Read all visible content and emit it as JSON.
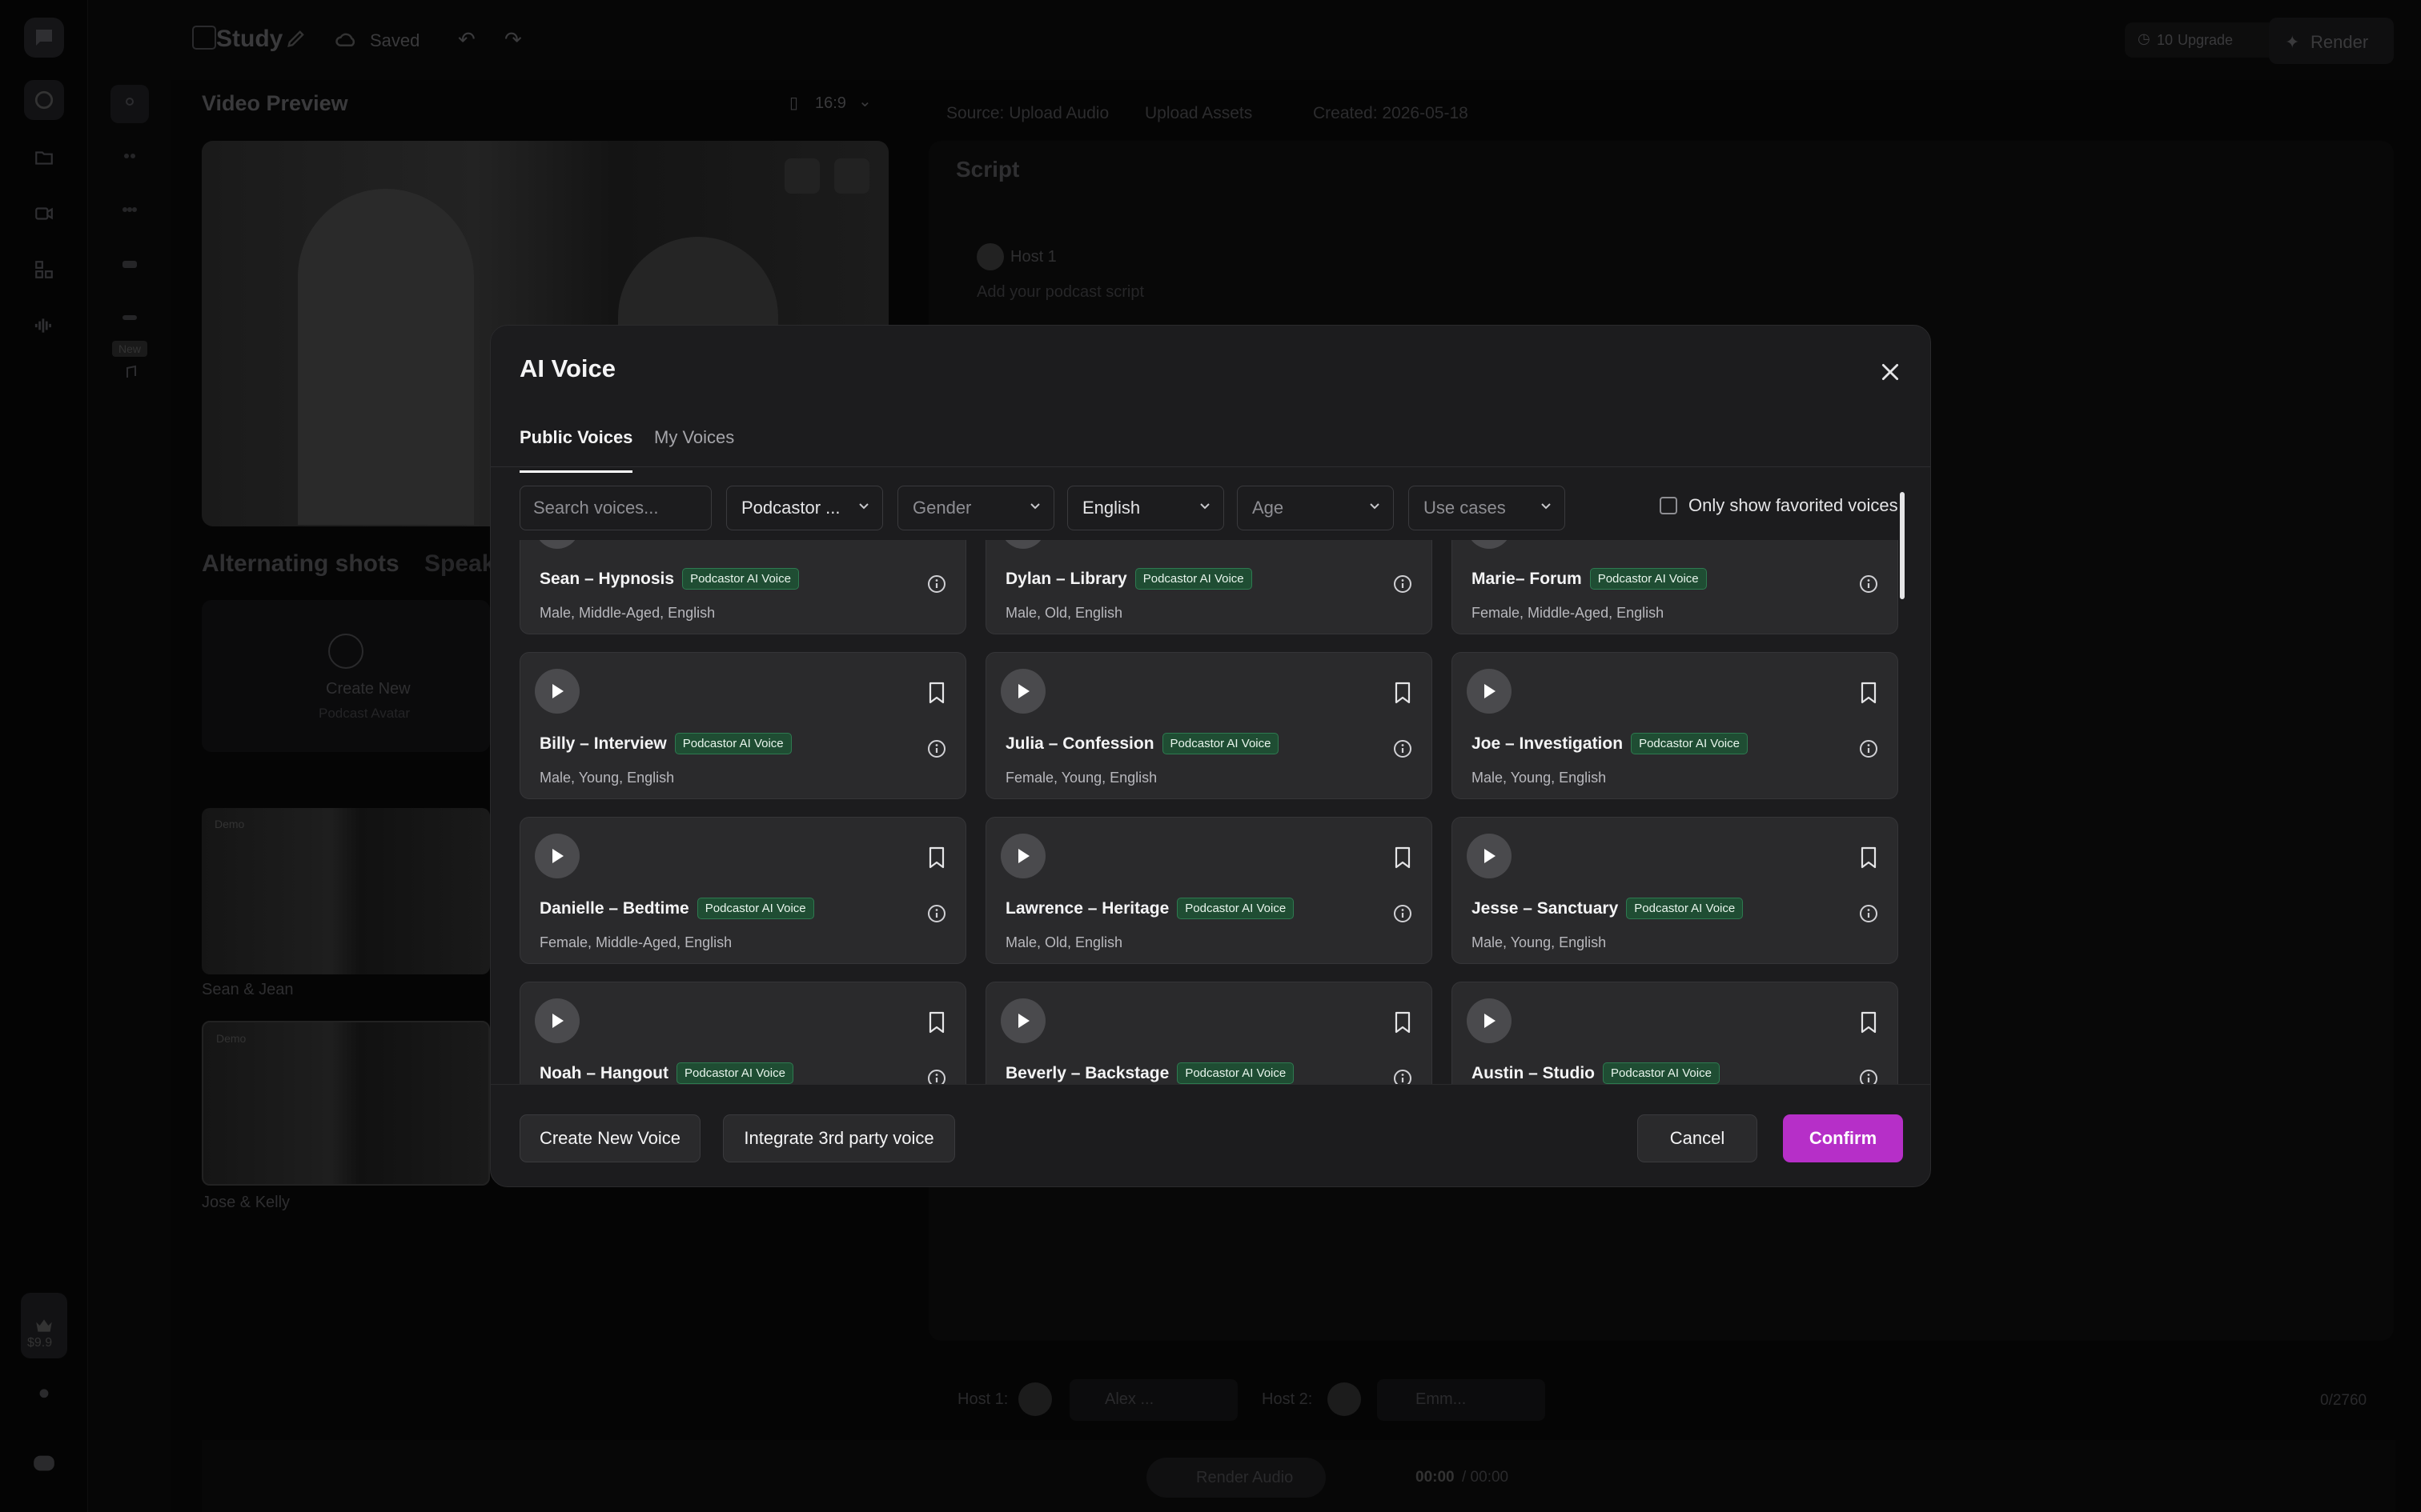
{
  "background": {
    "project_title": "Study",
    "save_status": "Saved",
    "credits": "10",
    "upgrade_label": "Upgrade",
    "render_label": "Render",
    "video_preview_title": "Video Preview",
    "aspect_ratio": "16:9",
    "source_label": "Source: Upload Audio",
    "upload_assets_label": "Upload Assets",
    "created_label": "Created: 2026-05-18",
    "script_title": "Script",
    "host1_label": "Host 1",
    "script_placeholder": "Add your podcast script",
    "alternating_shots": "Alternating shots",
    "speaker_tab": "Speak",
    "create_new_label": "Create New",
    "podcast_avatar_label": "Podcast Avatar",
    "demo_badge": "Demo",
    "thumb1_label": "Sean & Jean",
    "thumb2_label": "Jose & Kelly",
    "new_badge": "New",
    "price": "$9.9",
    "host1_prefix": "Host 1:",
    "host1_voice": "Alex ...",
    "host2_prefix": "Host 2:",
    "host2_voice": "Emm...",
    "char_count": "0/2760",
    "render_audio_label": "Render Audio",
    "time_current": "00:00",
    "time_total": "/ 00:00"
  },
  "modal": {
    "title": "AI Voice",
    "tabs": [
      {
        "label": "Public Voices",
        "active": true
      },
      {
        "label": "My Voices",
        "active": false
      }
    ],
    "search_placeholder": "Search voices...",
    "filters": {
      "category": "Podcastor ...",
      "gender": "Gender",
      "language": "English",
      "age": "Age",
      "use_cases": "Use cases"
    },
    "favorites_label": "Only show favorited voices",
    "voices": [
      {
        "name": "Sean – Hypnosis",
        "badge": "Podcastor AI Voice",
        "meta": "Male, Middle-Aged, English"
      },
      {
        "name": "Dylan – Library",
        "badge": "Podcastor AI Voice",
        "meta": "Male, Old, English"
      },
      {
        "name": "Marie– Forum",
        "badge": "Podcastor AI Voice",
        "meta": "Female, Middle-Aged, English"
      },
      {
        "name": "Billy – Interview",
        "badge": "Podcastor AI Voice",
        "meta": "Male, Young, English"
      },
      {
        "name": "Julia – Confession",
        "badge": "Podcastor AI Voice",
        "meta": "Female, Young, English"
      },
      {
        "name": "Joe – Investigation",
        "badge": "Podcastor AI Voice",
        "meta": "Male, Young, English"
      },
      {
        "name": "Danielle – Bedtime",
        "badge": "Podcastor AI Voice",
        "meta": "Female, Middle-Aged, English"
      },
      {
        "name": "Lawrence – Heritage",
        "badge": "Podcastor AI Voice",
        "meta": "Male, Old, English"
      },
      {
        "name": "Jesse – Sanctuary",
        "badge": "Podcastor AI Voice",
        "meta": "Male, Young, English"
      },
      {
        "name": "Noah – Hangout",
        "badge": "Podcastor AI Voice",
        "meta": ""
      },
      {
        "name": "Beverly – Backstage",
        "badge": "Podcastor AI Voice",
        "meta": ""
      },
      {
        "name": "Austin – Studio",
        "badge": "Podcastor AI Voice",
        "meta": ""
      }
    ],
    "buttons": {
      "create_voice": "Create New Voice",
      "integrate": "Integrate 3rd party voice",
      "cancel": "Cancel",
      "confirm": "Confirm"
    },
    "colors": {
      "confirm_bg": "#b62fc8",
      "badge_bg": "#1f4d33"
    }
  }
}
